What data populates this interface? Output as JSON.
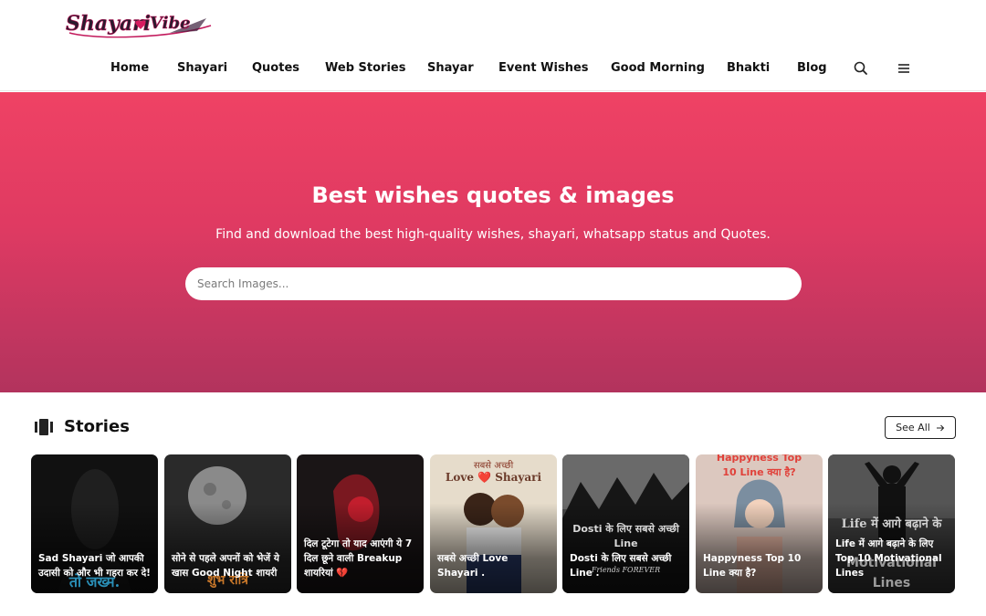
{
  "logo": {
    "text": "ShayariVibe"
  },
  "nav": {
    "items": [
      "Home",
      "Shayari",
      "Quotes",
      "Web Stories",
      "Shayar",
      "Event Wishes",
      "Good Morning",
      "Bhakti",
      "Blog"
    ],
    "icons": [
      "search-icon",
      "menu-icon"
    ]
  },
  "hero": {
    "title": "Best wishes quotes & images",
    "subtitle": "Find and download the best high-quality wishes, shayari, whatsapp status and Quotes.",
    "search_placeholder": "Search Images..."
  },
  "stories": {
    "title": "Stories",
    "see_all": "See All",
    "cards": [
      {
        "caption": "Sad Shayari जो आपकी उदासी को और भी गहरा कर दे!",
        "overlay": "तो जख्म."
      },
      {
        "caption": "सोने से पहले अपनों को भेजें ये खास Good Night शायरी",
        "overlay": "शुभ रात्रि"
      },
      {
        "caption": "दिल टूटेगा तो याद आएंगी ये 7 दिल छूने वाली Breakup शायरियां 💔",
        "overlay": ""
      },
      {
        "caption": "सबसे अच्छी Love Shayari .",
        "overlay": "Love ❤️ Shayari",
        "overlay_top": "सबसे अच्छी"
      },
      {
        "caption": "Dosti के लिए सबसे अच्छी Line .",
        "overlay": "Dosti के लिए सबसे अच्छी Line",
        "overlay_small": "Friends FOREVER"
      },
      {
        "caption": "Happyness Top 10 Line क्या है?",
        "overlay": "Happyness Top 10 Line क्या है?"
      },
      {
        "caption": "Life में आगे बढ़ाने के लिए Top 10 Motivational Lines",
        "overlay": "Life में आगे बढ़ाने के",
        "overlay_bottom": "Motivational Lines"
      }
    ]
  },
  "colors": {
    "hero_top": "#ef4264",
    "hero_bottom": "#b2335d",
    "logo_pink": "#c2185b"
  }
}
